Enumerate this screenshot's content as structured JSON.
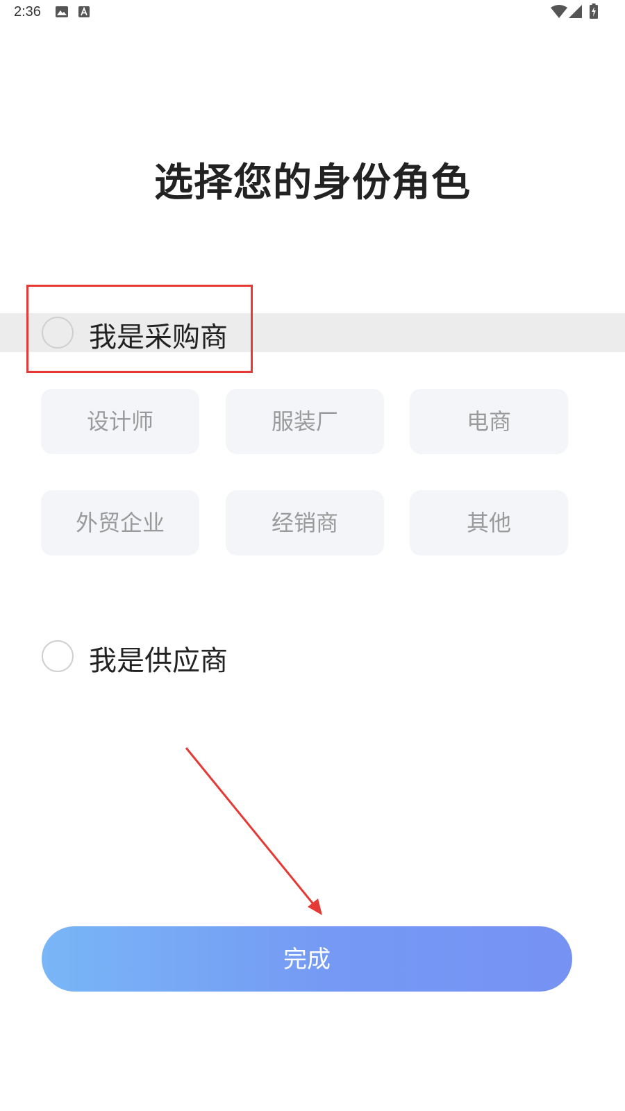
{
  "status_bar": {
    "time": "2:36",
    "icons": [
      "image-icon",
      "a-letter-icon",
      "wifi-icon",
      "signal-icon",
      "battery-charging-icon"
    ]
  },
  "page": {
    "title": "选择您的身份角色"
  },
  "roles": {
    "buyer": {
      "label": "我是采购商",
      "selected": false
    },
    "buyer_types": [
      "设计师",
      "服装厂",
      "电商",
      "外贸企业",
      "经销商",
      "其他"
    ],
    "supplier": {
      "label": "我是供应商",
      "selected": false
    }
  },
  "actions": {
    "done_label": "完成"
  },
  "colors": {
    "title": "#222222",
    "chip_bg": "#f4f5f8",
    "chip_text": "#9a9a9a",
    "button_gradient_start": "#79b6f6",
    "button_gradient_end": "#7692f3",
    "annotation_red": "#e53935"
  }
}
